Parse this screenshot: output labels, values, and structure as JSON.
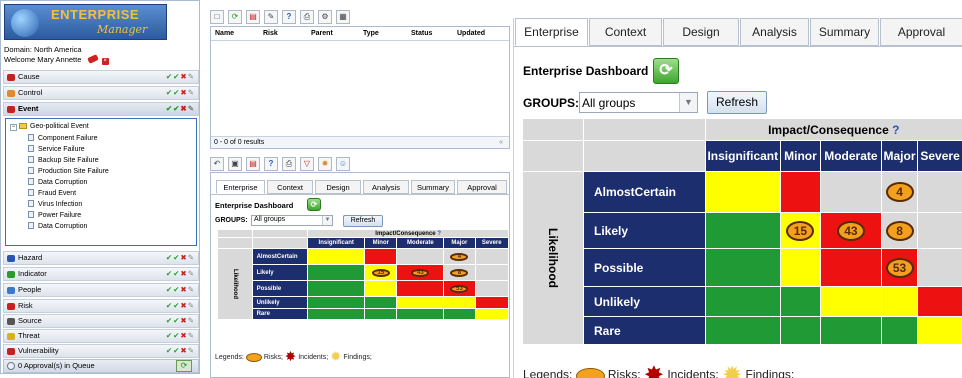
{
  "logo": {
    "line1": "ENTERPRISE",
    "line2": "Manager"
  },
  "session": {
    "domain": "Domain: North America",
    "welcome": "Welcome Mary Annette"
  },
  "sidebar": {
    "sections": [
      {
        "label": "Cause",
        "open": false,
        "color": "#c82020"
      },
      {
        "label": "Control",
        "open": false,
        "color": "#e48a2c"
      },
      {
        "label": "Event",
        "open": true,
        "color": "#c82020"
      },
      {
        "label": "Hazard",
        "open": false,
        "color": "#2a56b0"
      },
      {
        "label": "Indicator",
        "open": false,
        "color": "#2a9a2a"
      },
      {
        "label": "People",
        "open": false,
        "color": "#3a78c8"
      },
      {
        "label": "Risk",
        "open": false,
        "color": "#c82020"
      },
      {
        "label": "Source",
        "open": false,
        "color": "#555555"
      },
      {
        "label": "Threat",
        "open": false,
        "color": "#d8b020"
      },
      {
        "label": "Vulnerability",
        "open": false,
        "color": "#c82020"
      }
    ],
    "tree_root": "Geo-political Event",
    "tree_items": [
      "Component Failure",
      "Service Failure",
      "Backup Site Failure",
      "Production Site Failure",
      "Data Corruption",
      "Fraud Event",
      "Virus Infection",
      "Power Failure",
      "Data Corruption"
    ],
    "queue": "0 Approval(s) in Queue"
  },
  "grid": {
    "columns": [
      "Name",
      "Risk",
      "Parent",
      "Type",
      "Status",
      "Updated"
    ],
    "footer": "0 - 0 of 0 results"
  },
  "dashboard": {
    "tabs": [
      "Enterprise",
      "Context",
      "Design",
      "Analysis",
      "Summary",
      "Approval"
    ],
    "active_tab": "Enterprise",
    "title": "Enterprise Dashboard",
    "groups_label": "GROUPS:",
    "groups_value": "All groups",
    "refresh_label": "Refresh",
    "impact_header": "Impact/Consequence",
    "help_mark": "?",
    "impact_levels": [
      "Insignificant",
      "Minor",
      "Moderate",
      "Major",
      "Severe"
    ],
    "likelihood_label": "Likelihood",
    "likelihood_levels": [
      "AlmostCertain",
      "Likely",
      "Possible",
      "Unlikely",
      "Rare"
    ],
    "cell_colors": [
      [
        "y",
        "r",
        "gr",
        "gr",
        "gr"
      ],
      [
        "g",
        "y",
        "r",
        "gr",
        "gr"
      ],
      [
        "g",
        "y",
        "r",
        "r",
        "gr"
      ],
      [
        "g",
        "g",
        "y",
        "y",
        "r"
      ],
      [
        "g",
        "g",
        "g",
        "g",
        "y"
      ]
    ],
    "badges": [
      [
        "",
        "",
        "",
        "4",
        ""
      ],
      [
        "",
        "15",
        "43",
        "8",
        ""
      ],
      [
        "",
        "",
        "",
        "53",
        ""
      ],
      [
        "",
        "",
        "",
        "",
        ""
      ],
      [
        "",
        "",
        "",
        "",
        ""
      ]
    ],
    "legend_label": "Legends:",
    "legend_items": [
      "Risks;",
      "Incidents;",
      "Findings;"
    ]
  }
}
